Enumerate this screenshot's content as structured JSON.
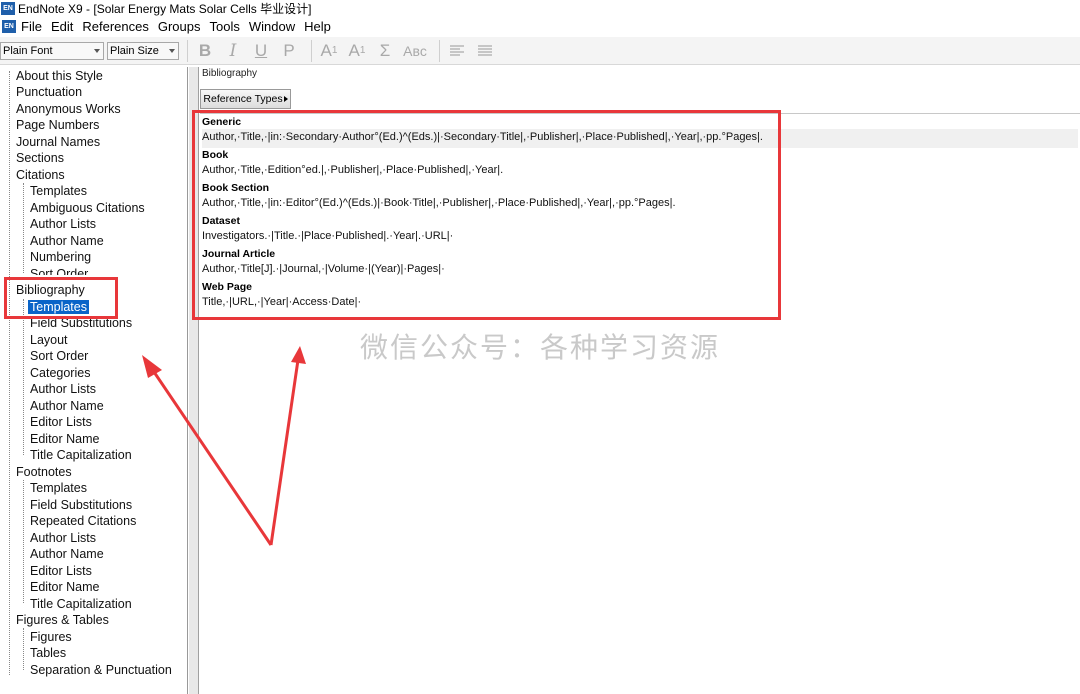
{
  "window": {
    "title": "EndNote X9 - [Solar Energy Mats Solar Cells 毕业设计]",
    "app_icon": "EN"
  },
  "menu": {
    "doc_icon": "EN",
    "items": [
      "File",
      "Edit",
      "References",
      "Groups",
      "Tools",
      "Window",
      "Help"
    ]
  },
  "toolbar": {
    "font_select": "Plain Font",
    "size_select": "Plain Size",
    "format_buttons": [
      "B",
      "I",
      "U",
      "P"
    ],
    "superscript_base": "A",
    "superscript_mark": "1",
    "subscript_base": "A",
    "subscript_mark": "1",
    "symbol": "Σ",
    "smallcaps": "Aʙᴄ"
  },
  "tree": {
    "items": [
      "About this Style",
      "Punctuation",
      "Anonymous Works",
      "Page Numbers",
      "Journal Names",
      "Sections",
      "Citations",
      "Templates",
      "Ambiguous Citations",
      "Author Lists",
      "Author Name",
      "Numbering",
      "Sort Order",
      "Bibliography",
      "Templates",
      "Field Substitutions",
      "Layout",
      "Sort Order",
      "Categories",
      "Author Lists",
      "Author Name",
      "Editor Lists",
      "Editor Name",
      "Title Capitalization",
      "Footnotes",
      "Templates",
      "Field Substitutions",
      "Repeated Citations",
      "Author Lists",
      "Author Name",
      "Editor Lists",
      "Editor Name",
      "Title Capitalization",
      "Figures & Tables",
      "Figures",
      "Tables",
      "Separation & Punctuation"
    ]
  },
  "main": {
    "section_label": "Bibliography",
    "ref_types_button": "Reference Types",
    "templates": [
      {
        "type": "Generic",
        "text": "Author,·Title,·|in:·Secondary·Author°(Ed.)^(Eds.)|·Secondary·Title|,·Publisher|,·Place·Published|,·Year|,·pp.°Pages|."
      },
      {
        "type": "Book",
        "text": "Author,·Title,·Edition°ed.|,·Publisher|,·Place·Published|,·Year|."
      },
      {
        "type": "Book Section",
        "text": "Author,·Title,·|in:·Editor°(Ed.)^(Eds.)|·Book·Title|,·Publisher|,·Place·Published|,·Year|,·pp.°Pages|."
      },
      {
        "type": "Dataset",
        "text": "Investigators.·|Title.·|Place·Published|.·Year|.·URL|·"
      },
      {
        "type": "Journal Article",
        "text": "Author,·Title[J].·|Journal,·|Volume·|(Year)|·Pages|·"
      },
      {
        "type": "Web Page",
        "text": "Title,·|URL,·|Year|·Access·Date|·"
      }
    ]
  },
  "watermark": "微信公众号：各种学习资源",
  "annotation_color": "#e8373a"
}
